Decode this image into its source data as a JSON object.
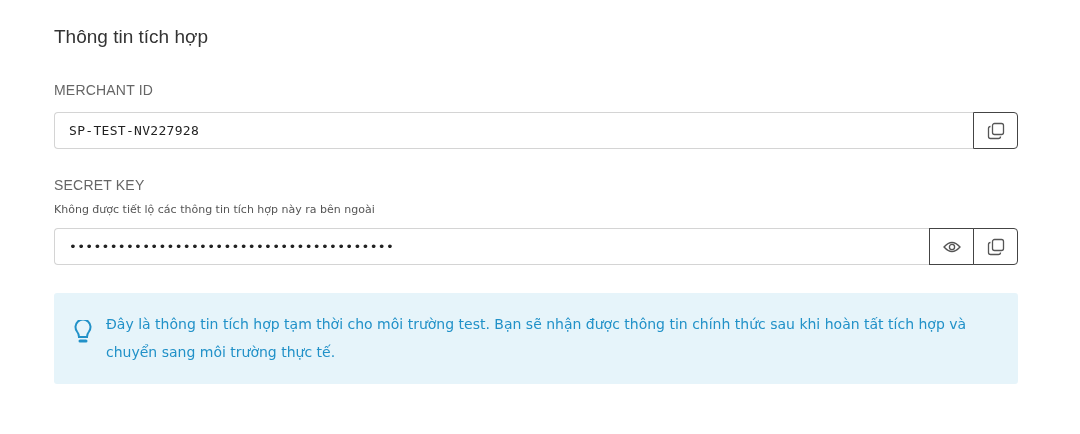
{
  "section": {
    "title": "Thông tin tích hợp"
  },
  "fields": [
    {
      "label": "MERCHANT ID",
      "value": "SP-TEST-NV227928",
      "actions": [
        {
          "kind": "copy"
        }
      ]
    },
    {
      "label": "SECRET KEY",
      "hint": "Không được tiết lộ các thông tin tích hợp này ra bên ngoài",
      "value": "••••••••••••••••••••••••••••••••••••••••",
      "actions": [
        {
          "kind": "reveal"
        },
        {
          "kind": "copy"
        }
      ]
    }
  ],
  "notice": {
    "text": "Đây là thông tin tích hợp tạm thời cho môi trường test. Bạn sẽ nhận được thông tin chính thức sau khi hoàn tất tích hợp và chuyển sang môi trường thực tế."
  }
}
